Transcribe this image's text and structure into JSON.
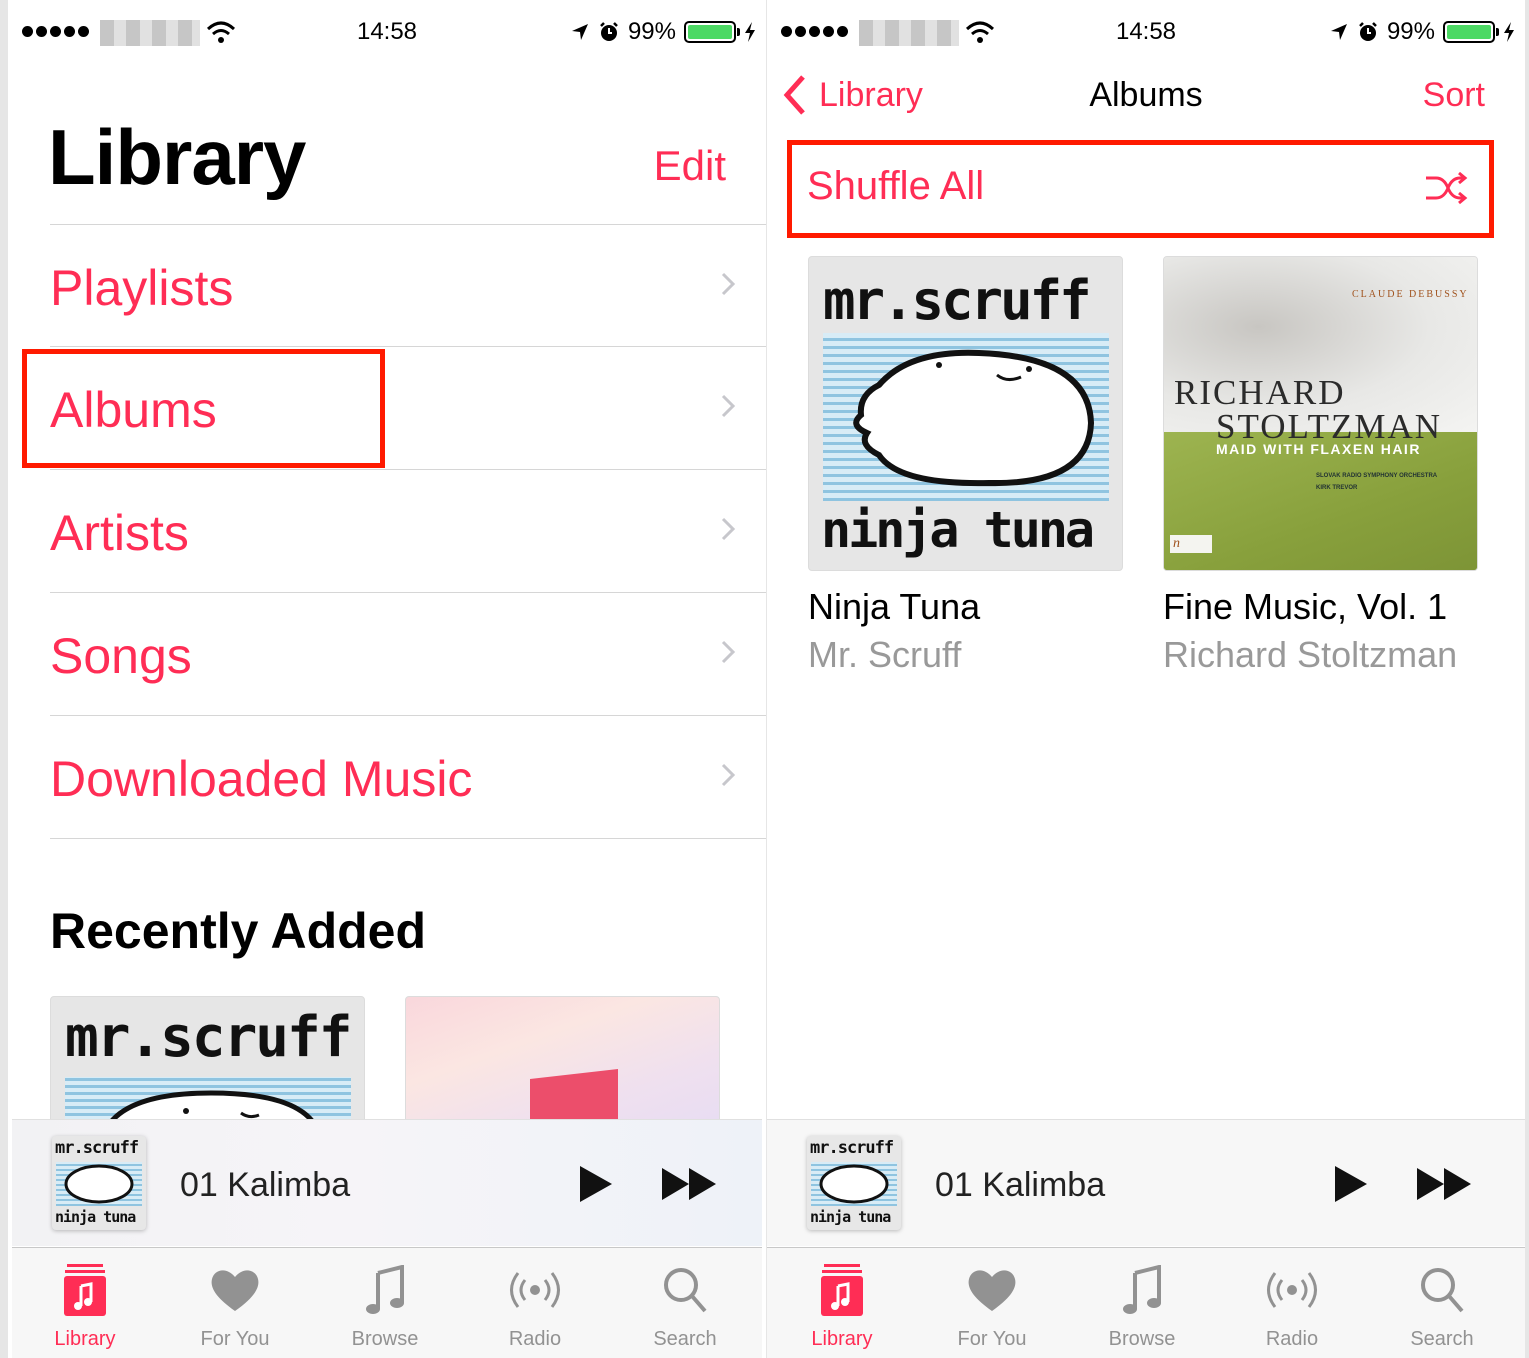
{
  "status": {
    "time": "14:58",
    "battery": "99%"
  },
  "left": {
    "title": "Library",
    "edit": "Edit",
    "menu": [
      {
        "label": "Playlists"
      },
      {
        "label": "Albums"
      },
      {
        "label": "Artists"
      },
      {
        "label": "Songs"
      },
      {
        "label": "Downloaded Music"
      }
    ],
    "recent_heading": "Recently Added",
    "art_text": {
      "top": "mr.scruff",
      "bottom": "ninja tuna"
    }
  },
  "right": {
    "back": "Library",
    "title": "Albums",
    "sort": "Sort",
    "shuffle": "Shuffle All",
    "albums": [
      {
        "title": "Ninja Tuna",
        "artist": "Mr. Scruff",
        "art_top": "mr.scruff",
        "art_bottom": "ninja tuna"
      },
      {
        "title": "Fine Music, Vol. 1",
        "artist": "Richard Stoltzman",
        "art_composer": "CLAUDE DEBUSSY",
        "art_name1": "RICHARD",
        "art_name2": "STOLTZMAN",
        "art_subtitle": "MAID WITH FLAXEN HAIR",
        "art_orch1": "SLOVAK RADIO SYMPHONY ORCHESTRA",
        "art_orch2": "KIRK TREVOR",
        "art_label": "n"
      }
    ]
  },
  "player": {
    "track": "01 Kalimba"
  },
  "tabs": [
    {
      "label": "Library",
      "icon": "library-icon"
    },
    {
      "label": "For You",
      "icon": "heart-icon"
    },
    {
      "label": "Browse",
      "icon": "music-note-icon"
    },
    {
      "label": "Radio",
      "icon": "radio-icon"
    },
    {
      "label": "Search",
      "icon": "search-icon"
    }
  ],
  "colors": {
    "accent": "#ff2d55",
    "highlight_box": "#ff1a00",
    "inactive": "#929292"
  }
}
